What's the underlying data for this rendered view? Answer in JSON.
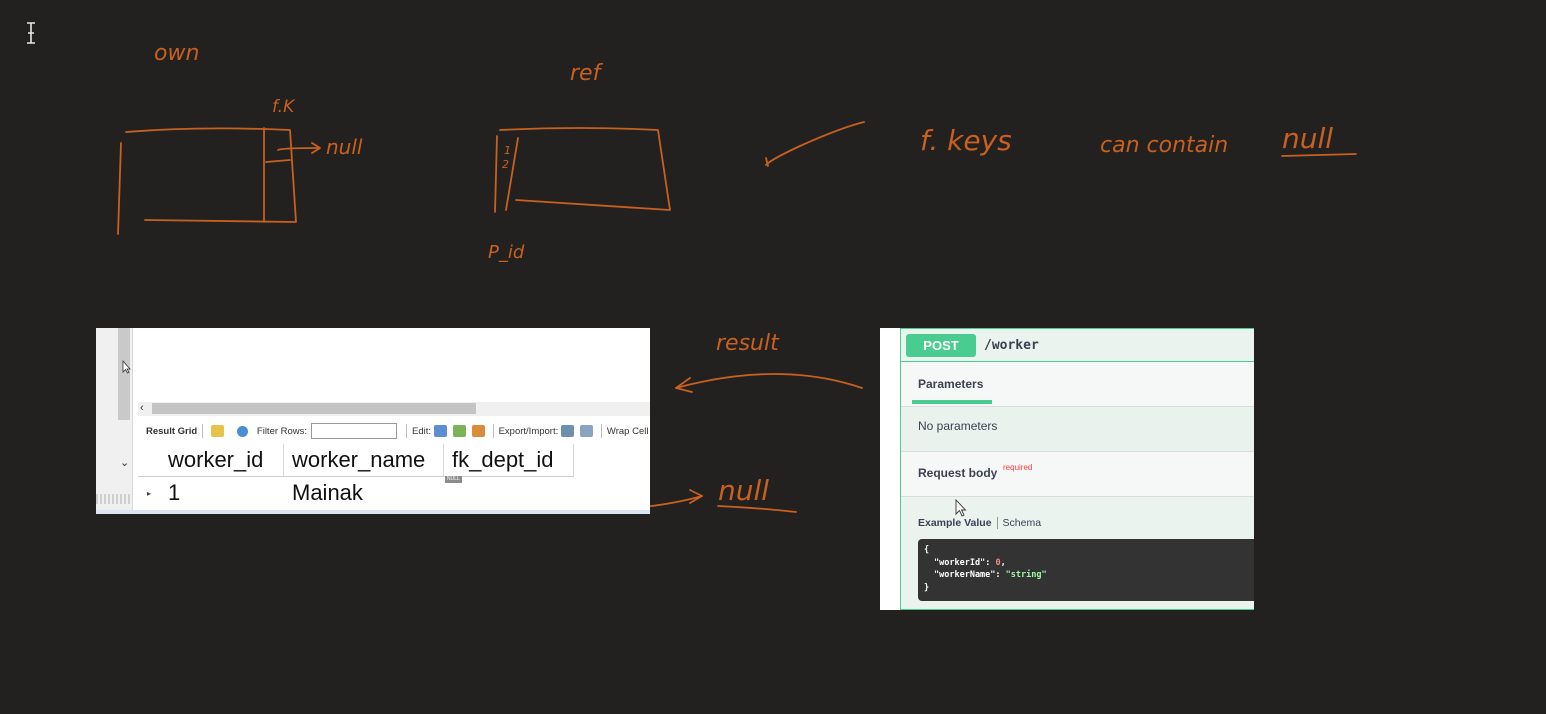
{
  "whiteboard": {
    "label_own": "own",
    "label_fk": "f.K",
    "label_null_arrow": "null",
    "label_ref": "ref",
    "label_row_1": "1",
    "label_row_2": "2",
    "label_pid": "P_id",
    "note_fkeys": "f. keys",
    "note_can_contain": "can contain",
    "note_null": "null",
    "label_result": "result",
    "label_null_result": "null",
    "ink_color": "#c8601f"
  },
  "mysql_panel": {
    "toolbar": {
      "result_grid": "Result Grid",
      "filter_rows": "Filter Rows:",
      "edit": "Edit:",
      "export_import": "Export/Import:",
      "wrap_cell": "Wrap Cell C"
    },
    "columns": [
      "worker_id",
      "worker_name",
      "fk_dept_id"
    ],
    "row": {
      "worker_id": "1",
      "worker_name": "Mainak",
      "fk_dept_id": ""
    },
    "null_badge": "NULL"
  },
  "swagger_panel": {
    "method": "POST",
    "path": "/worker",
    "tab_parameters": "Parameters",
    "no_parameters": "No parameters",
    "request_body": "Request body",
    "required": "required",
    "example_value": "Example Value",
    "schema": "Schema",
    "code": {
      "open": "{",
      "key1": "\"workerId\"",
      "val1": "0",
      "key2": "\"workerName\"",
      "val2": "\"string\"",
      "close": "}"
    },
    "accent_color": "#49cc90"
  }
}
